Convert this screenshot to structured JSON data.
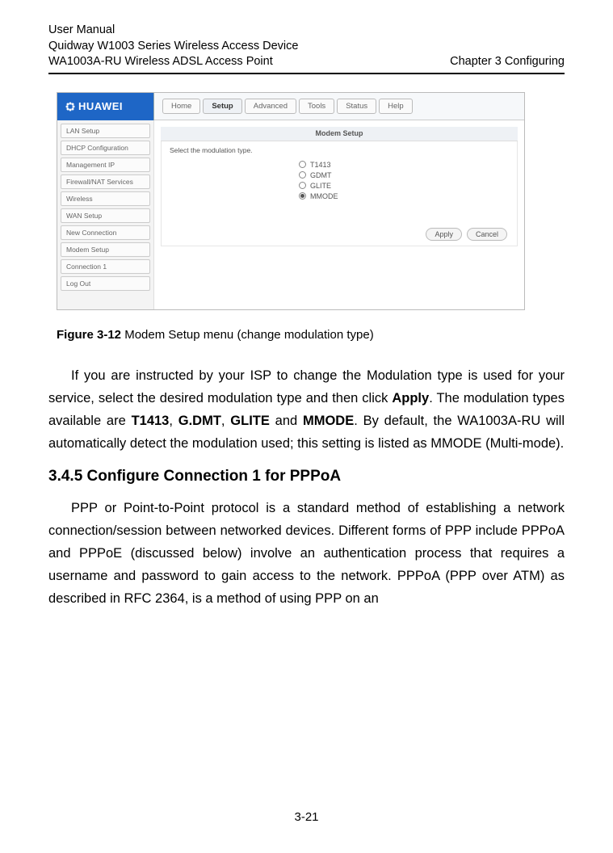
{
  "header": {
    "line1": "User Manual",
    "line2": "Quidway W1003 Series Wireless Access Device",
    "line3_left": "WA1003A-RU Wireless ADSL Access Point",
    "line3_right": "Chapter 3  Configuring"
  },
  "screenshot": {
    "brand": "HUAWEI",
    "topnav": [
      "Home",
      "Setup",
      "Advanced",
      "Tools",
      "Status",
      "Help"
    ],
    "topnav_active_index": 1,
    "sidebar": [
      "LAN Setup",
      "DHCP Configuration",
      "Management IP",
      "Firewall/NAT Services",
      "Wireless",
      "WAN Setup",
      "New Connection",
      "Modem Setup",
      "Connection 1",
      "Log Out"
    ],
    "panel_title": "Modem Setup",
    "panel_prompt": "Select the modulation type.",
    "options": [
      "T1413",
      "GDMT",
      "GLITE",
      "MMODE"
    ],
    "selected_index": 3,
    "buttons": [
      "Apply",
      "Cancel"
    ]
  },
  "figure": {
    "label": "Figure 3-12",
    "caption": " Modem Setup menu (change modulation type)"
  },
  "para1": {
    "t1": "If you are instructed by your ISP to change the Modulation type is used for your service, select the desired modulation type and then click ",
    "b1": "Apply",
    "t2": ". The modulation types available are ",
    "b2": "T1413",
    "t3": ", ",
    "b3": "G.DMT",
    "t4": ", ",
    "b4": "GLITE",
    "t5": " and ",
    "b5": "MMODE",
    "t6": ". By default, the WA1003A-RU will automatically detect the modulation used; this setting is listed as MMODE (Multi-mode)."
  },
  "heading": "3.4.5  Configure Connection 1 for PPPoA",
  "para2": "PPP or Point-to-Point protocol is a standard method of establishing a network connection/session between networked devices. Different forms of PPP include PPPoA and PPPoE (discussed below) involve an authentication process that requires a username and password to gain access to the network. PPPoA (PPP over ATM) as described in RFC 2364, is a method of using PPP on an",
  "page_number": "3-21"
}
